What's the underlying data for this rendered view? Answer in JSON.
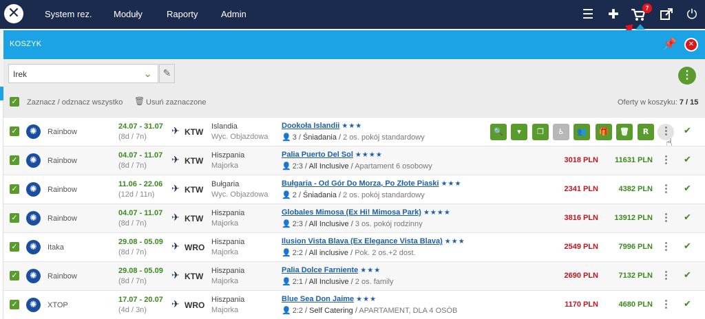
{
  "nav": {
    "items": [
      "System rez.",
      "Moduły",
      "Raporty",
      "Admin"
    ],
    "cart_count": "7"
  },
  "panel": {
    "title": "KOSZYK"
  },
  "filter": {
    "selected": "Irek"
  },
  "toolbar": {
    "select_all": "Zaznacz / odznacz wszystko",
    "delete_selected": "Usuń zaznaczone",
    "offers_label": "Oferty w koszyku:",
    "offers_count": "7 / 15"
  },
  "first_row_actions": [
    "search",
    "dropdown",
    "copy",
    "wheelchair",
    "group",
    "gift",
    "trash",
    "R"
  ],
  "rows": [
    {
      "operator": "Rainbow",
      "dates": "24.07 - 31.07",
      "nights": "(8d / 7n)",
      "airport": "KTW",
      "country": "Islandia",
      "region": "Wyc. Objazdowa",
      "hotel": "Dookoła Islandii",
      "stars": "★★★",
      "pax": "3",
      "board": "Śniadania",
      "room": "2 os. pokój standardowy",
      "price_person": "",
      "price_total": ""
    },
    {
      "operator": "Rainbow",
      "dates": "04.07 - 11.07",
      "nights": "(8d / 7n)",
      "airport": "KTW",
      "country": "Hiszpania",
      "region": "Majorka",
      "hotel": "Palia Puerto Del Sol",
      "stars": "★★★★",
      "pax": "2:3",
      "board": "All Inclusive",
      "room": "Apartament 6 osobowy",
      "price_person": "3018 PLN",
      "price_total": "11631 PLN"
    },
    {
      "operator": "Rainbow",
      "dates": "11.06 - 22.06",
      "nights": "(12d / 11n)",
      "airport": "KTW",
      "country": "Bułgaria",
      "region": "Wyc. Objazdowa",
      "hotel": "Bułgaria - Od Gór Do Morza, Po Złote Piaski",
      "stars": "★★★",
      "pax": "2",
      "board": "Śniadania",
      "room": "2 os. pokój standardowy",
      "price_person": "2341 PLN",
      "price_total": "4382 PLN"
    },
    {
      "operator": "Rainbow",
      "dates": "04.07 - 11.07",
      "nights": "(8d / 7n)",
      "airport": "KTW",
      "country": "Hiszpania",
      "region": "Majorka",
      "hotel": "Globales Mimosa (Ex Hi! Mimosa Park)",
      "stars": "★★★★",
      "pax": "2:3",
      "board": "All Inclusive",
      "room": "3 os. pokój rodzinny",
      "price_person": "3816 PLN",
      "price_total": "13912 PLN"
    },
    {
      "operator": "Itaka",
      "dates": "29.08 - 05.09",
      "nights": "(8d / 7n)",
      "airport": "WRO",
      "country": "Hiszpania",
      "region": "Majorka",
      "hotel": "Ilusion Vista Blava (Ex Elegance Vista Blava)",
      "stars": "★★★",
      "pax": "2:2",
      "board": "All inclusive",
      "room": "Pok. 2 os.+2 dost.",
      "price_person": "2549 PLN",
      "price_total": "7996 PLN"
    },
    {
      "operator": "Rainbow",
      "dates": "29.08 - 05.09",
      "nights": "(8d / 7n)",
      "airport": "KTW",
      "country": "Hiszpania",
      "region": "Majorka",
      "hotel": "Palia Dolce Farniente",
      "stars": "★★★",
      "pax": "2:1",
      "board": "All Inclusive",
      "room": "2 os. family",
      "price_person": "2690 PLN",
      "price_total": "7132 PLN"
    },
    {
      "operator": "XTOP",
      "dates": "17.07 - 20.07",
      "nights": "(4d / 3n)",
      "airport": "WRO",
      "country": "Hiszpania",
      "region": "Majorka",
      "hotel": "Blue Sea Don Jaime",
      "stars": "★★★",
      "pax": "2:2",
      "board": "Self Catering",
      "room": "APARTAMENT, DLA 4 OSÓB",
      "price_person": "1170 PLN",
      "price_total": "4680 PLN"
    }
  ]
}
